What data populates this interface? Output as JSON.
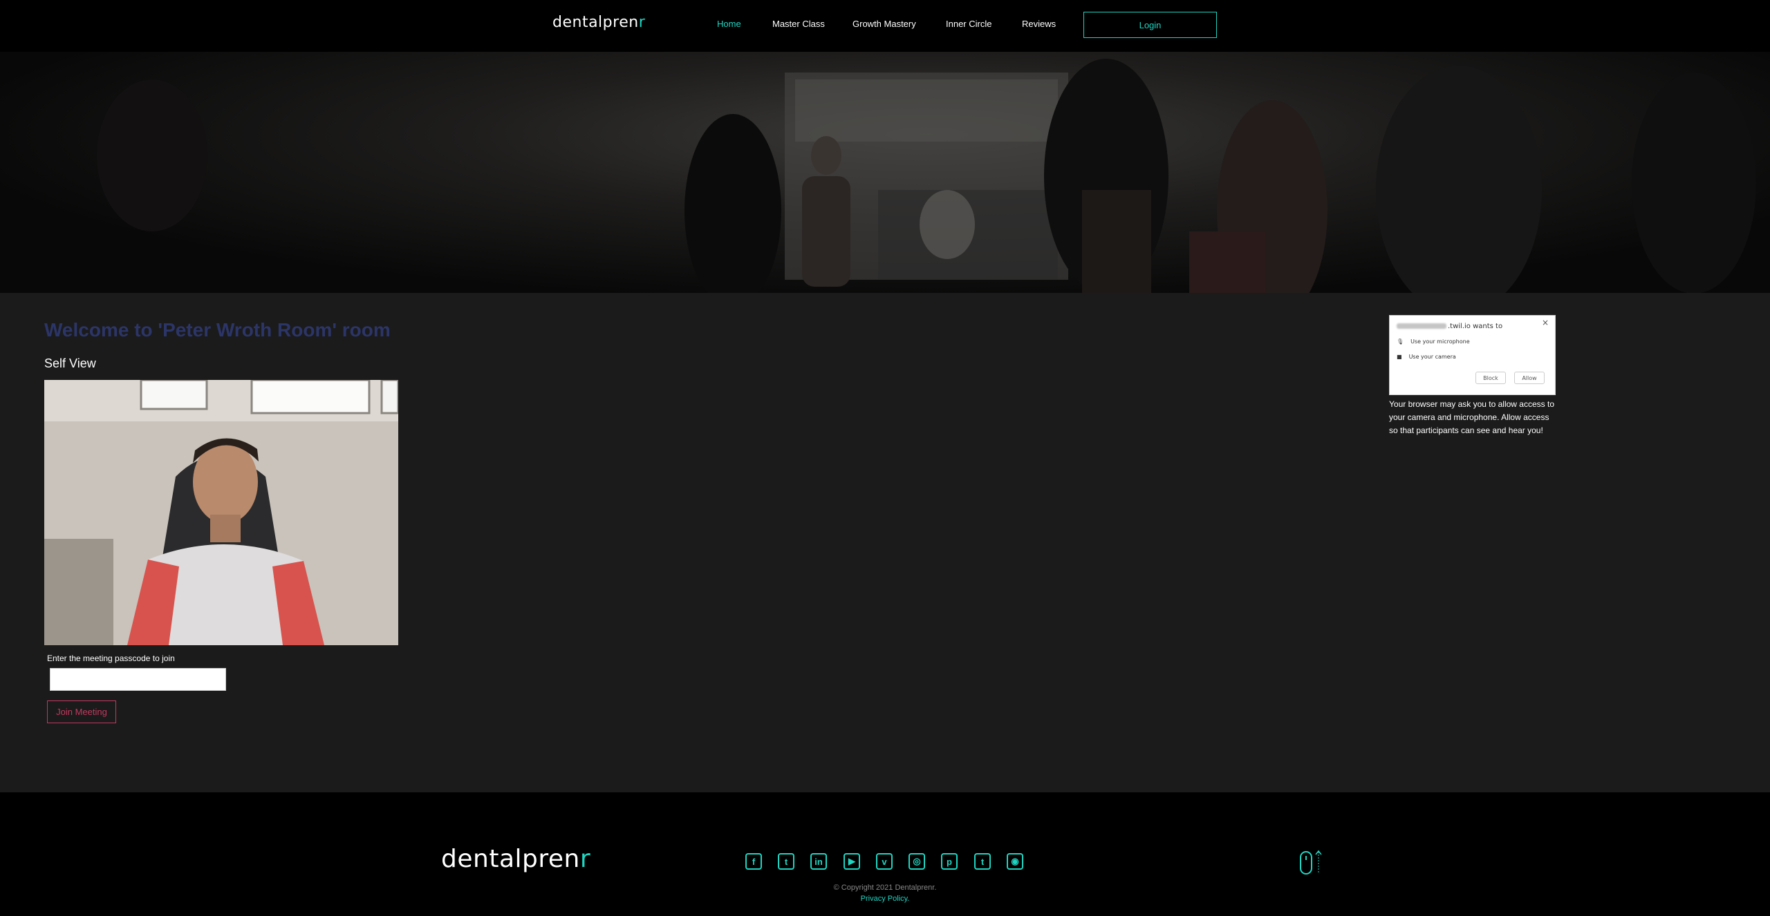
{
  "nav": {
    "logo_main": "dent",
    "logo_mid": "alpren",
    "logo_end": "r",
    "items": [
      "Home",
      "Master Class",
      "Growth Mastery",
      "Inner Circle",
      "Reviews"
    ],
    "login": "Login"
  },
  "main": {
    "welcome": "Welcome to 'Peter Wroth Room' room",
    "self_view": "Self View",
    "passcode_label": "Enter the meeting passcode to join",
    "passcode_value": "",
    "join_button": "Join Meeting"
  },
  "permission": {
    "title_suffix": ".twil.io wants to",
    "mic": "Use your microphone",
    "camera": "Use your camera",
    "block": "Block",
    "allow": "Allow",
    "close": "×"
  },
  "help_text": "Your browser may ask you to allow access to your camera and microphone. Allow access so that participants can see and hear you!",
  "footer": {
    "social": [
      "facebook-icon",
      "twitter-icon",
      "linkedin-icon",
      "youtube-icon",
      "vimeo-icon",
      "instagram-icon",
      "pinterest-icon",
      "tumblr-icon",
      "rss-icon"
    ],
    "social_glyphs": [
      "f",
      "t",
      "in",
      "▶",
      "v",
      "◎",
      "p",
      "t",
      "◉"
    ],
    "copyright": "© Copyright 2021 Dentalprenr.",
    "privacy": "Privacy Policy."
  },
  "colors": {
    "accent": "#1fd6c3",
    "welcome": "#2c3568",
    "join": "#c4395f",
    "background": "#1b1b1b"
  }
}
